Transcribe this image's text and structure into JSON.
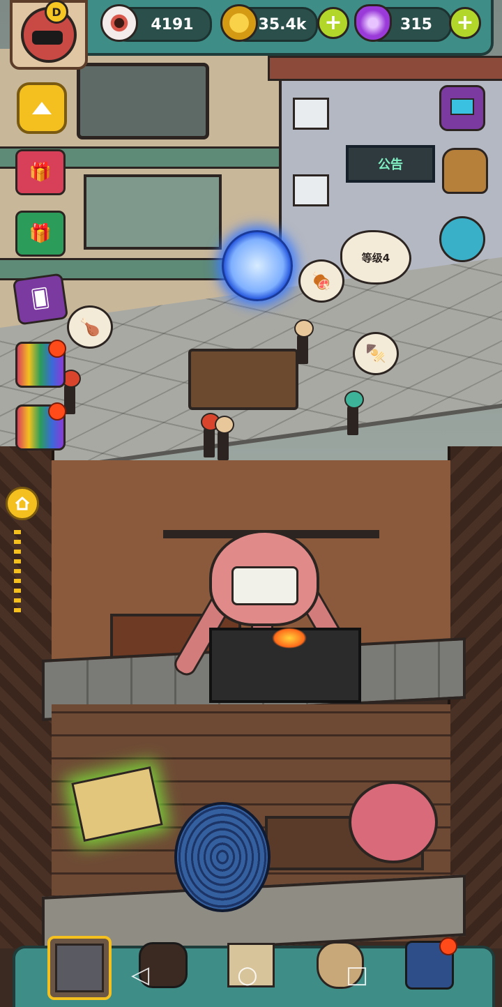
{
  "hud": {
    "player_rank": "D",
    "eyeballs": "4191",
    "coins": "35.4k",
    "potions": "315",
    "plus_symbol": "+"
  },
  "scene": {
    "notice_board": "公告",
    "level_bubble": "等级4"
  },
  "icons": {
    "eyeball": "eyeball-icon",
    "coin": "coin-icon",
    "potion": "potion-icon",
    "collapse": "triangle-up-icon",
    "home": "home-icon"
  },
  "bottom_nav": {
    "tabs": [
      "building",
      "monster",
      "book",
      "loot-bag",
      "inventory-grid"
    ],
    "active": "building"
  },
  "system_nav": {
    "back": "◁",
    "home": "○",
    "recents": "□"
  },
  "colors": {
    "hud_teal": "#3e8d86",
    "accent_yellow": "#f4c020",
    "plus_green": "#b2d62a",
    "alert_red": "#ff4a1a"
  }
}
